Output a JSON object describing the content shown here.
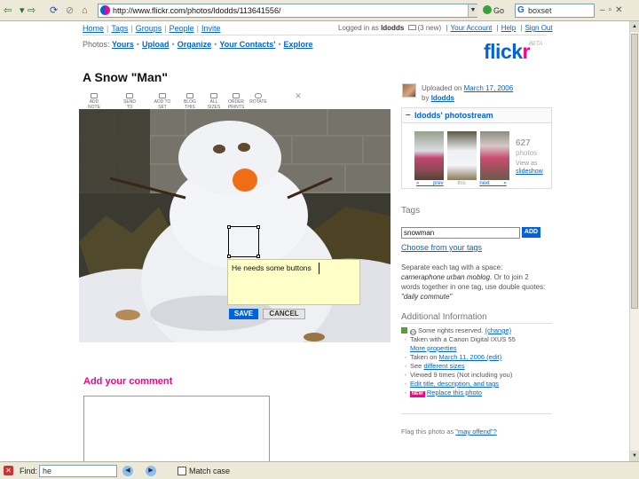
{
  "browser": {
    "url": "http://www.flickr.com/photos/ldodds/113641556/",
    "go_label": "Go",
    "search_value": "boxset",
    "window_controls": "–▫✕",
    "nav_icons": [
      "back-icon",
      "forward-icon",
      "reload-icon",
      "stop-icon",
      "home-icon"
    ]
  },
  "flickr_nav": {
    "links": [
      "Home",
      "Tags",
      "Groups",
      "People",
      "Invite"
    ],
    "logged_in_prefix": "Logged in as",
    "user": "ldodds",
    "new_mail": "(3 new)",
    "account_links": [
      "Your Account",
      "Help",
      "Sign Out"
    ],
    "photos_label": "Photos:",
    "photo_links": [
      "Yours",
      "Upload",
      "Organize",
      "Your Contacts'",
      "Explore"
    ],
    "logo_flick": "flick",
    "logo_r": "r",
    "logo_beta": "BETA"
  },
  "photo": {
    "title": "A Snow \"Man\"",
    "actions": [
      "ADD NOTE",
      "SEND TO GROUP",
      "ADD TO SET",
      "BLOG THIS",
      "ALL SIZES",
      "ORDER PRINTS",
      "ROTATE",
      "DELETE"
    ],
    "note_text": "He needs some buttons",
    "save_label": "SAVE",
    "cancel_label": "CANCEL"
  },
  "comment": {
    "heading": "Add your comment"
  },
  "sidebar": {
    "uploaded_prefix": "Uploaded on",
    "uploaded_date": "March 17, 2006",
    "by_prefix": "by",
    "uploader": "ldodds",
    "photostream_title": "ldodds' photostream",
    "photo_count": "627",
    "photo_count_unit": "photos",
    "view_as_label": "View as",
    "view_as_link": "slideshow",
    "stream_nav": [
      "« prev",
      "this",
      "next »"
    ],
    "tags_heading": "Tags",
    "tag_input_value": "snowman",
    "add_label": "ADD",
    "choose_tags": "Choose from your tags",
    "tag_help_1": "Separate each tag with a space:",
    "tag_help_example": "cameraphone urban moblog",
    "tag_help_2": ". Or to join 2 words together in one tag, use double quotes:",
    "tag_help_quote": "\"daily commute\"",
    "additional_heading": "Additional Information",
    "info_items": [
      {
        "type": "rights",
        "text": "Some rights reserved.",
        "link": "(change)"
      },
      {
        "type": "bullet",
        "text": "Taken with a Canon Digital IXUS 55",
        "link": ""
      },
      {
        "type": "indent",
        "text": "",
        "link": "More properties"
      },
      {
        "type": "bullet",
        "text": "Taken on ",
        "link": "March 11, 2006 (edit)"
      },
      {
        "type": "bullet",
        "text": "See ",
        "link": "different sizes"
      },
      {
        "type": "bullet",
        "text": "Viewed 9 times (Not including you)",
        "link": ""
      },
      {
        "type": "bullet",
        "text": "",
        "link": "Edit title, description, and tags"
      },
      {
        "type": "new",
        "text": "",
        "link": "Replace this photo"
      }
    ],
    "new_badge": "NEW",
    "flag_prefix": "Flag this photo as",
    "flag_link": "\"may offend\"?"
  },
  "findbar": {
    "close": "✕",
    "label": "Find:",
    "value": "he",
    "match_case": "Match case",
    "prev": "◀",
    "next": "▶"
  }
}
